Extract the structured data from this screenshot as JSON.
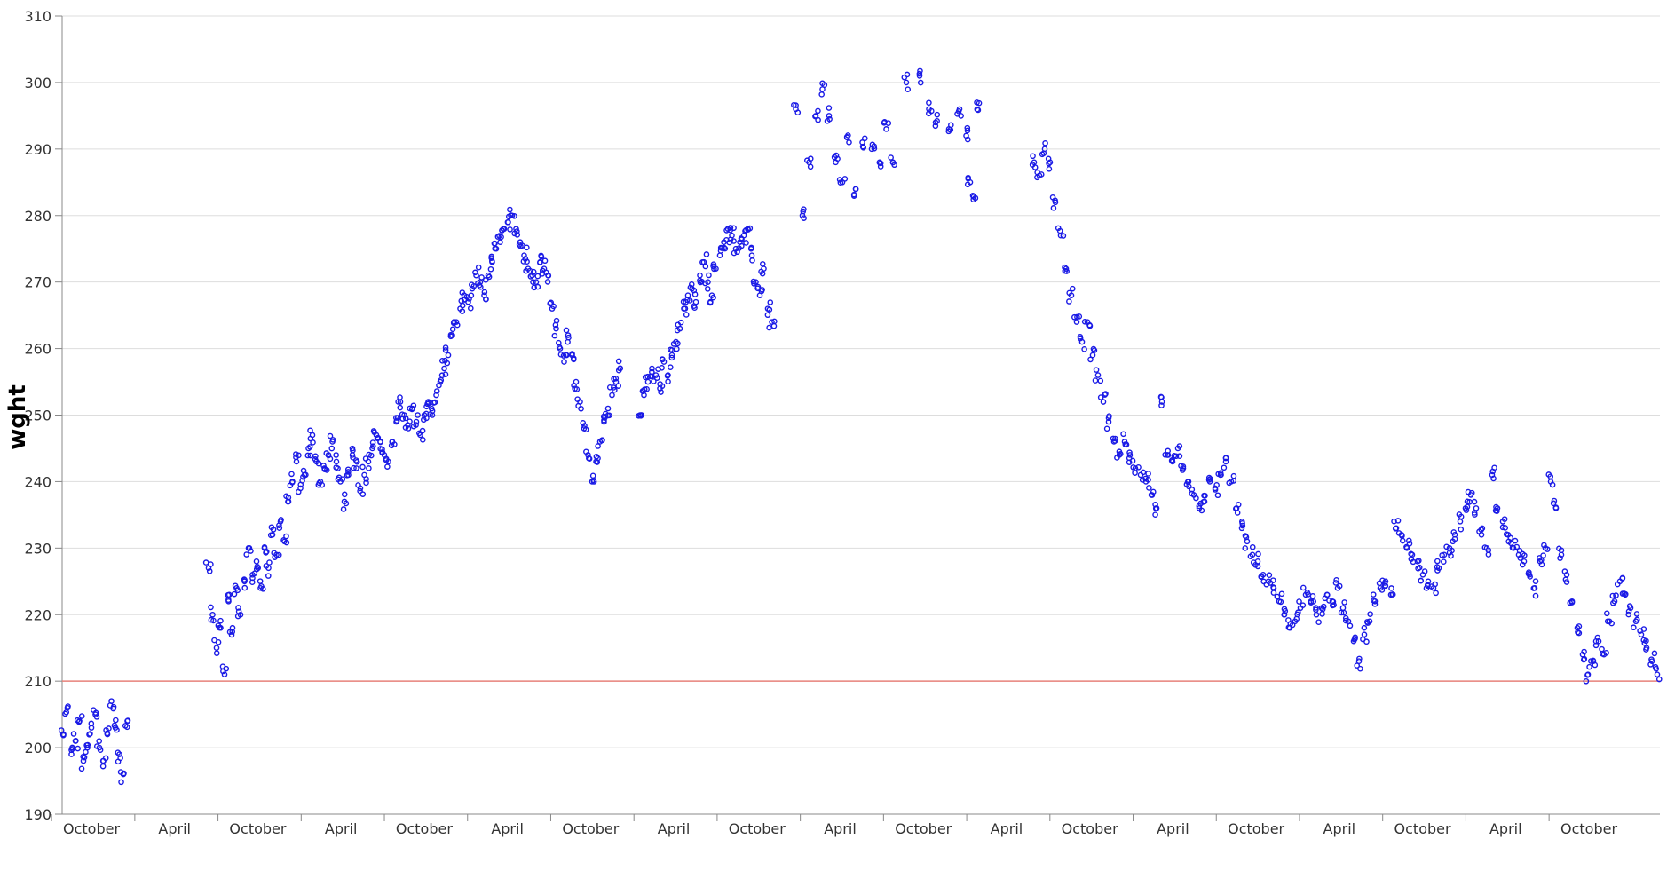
{
  "chart_data": {
    "type": "scatter",
    "title": "",
    "ylabel": "wght",
    "xlabel": "",
    "ylim": [
      190,
      310
    ],
    "yticks": [
      190,
      200,
      210,
      220,
      230,
      240,
      250,
      260,
      270,
      280,
      290,
      300,
      310
    ],
    "xticks": [
      "October",
      "April",
      "October",
      "April",
      "October",
      "April",
      "October",
      "April",
      "October",
      "April",
      "October",
      "April",
      "October",
      "April",
      "October",
      "April",
      "October",
      "April",
      "October"
    ],
    "reference_line": {
      "y": 210,
      "color": "#e8827a"
    },
    "marker": {
      "shape": "open-circle",
      "color": "#1a1ae6"
    },
    "grid": "horizontal",
    "points": [
      [
        0.1,
        202
      ],
      [
        0.4,
        206
      ],
      [
        0.7,
        199
      ],
      [
        1.0,
        201
      ],
      [
        1.3,
        204
      ],
      [
        1.6,
        198
      ],
      [
        1.9,
        200
      ],
      [
        2.2,
        203
      ],
      [
        2.5,
        205
      ],
      [
        2.8,
        200
      ],
      [
        3.1,
        198
      ],
      [
        3.4,
        202
      ],
      [
        3.7,
        207
      ],
      [
        4.0,
        203
      ],
      [
        4.3,
        199
      ],
      [
        4.6,
        196
      ],
      [
        4.9,
        204
      ],
      [
        11.0,
        227
      ],
      [
        11.3,
        220
      ],
      [
        11.6,
        215
      ],
      [
        11.9,
        218
      ],
      [
        12.2,
        211
      ],
      [
        12.5,
        222
      ],
      [
        12.8,
        218
      ],
      [
        13.1,
        224
      ],
      [
        13.4,
        220
      ],
      [
        13.7,
        225
      ],
      [
        14.0,
        230
      ],
      [
        14.3,
        226
      ],
      [
        14.6,
        228
      ],
      [
        14.9,
        224
      ],
      [
        15.2,
        230
      ],
      [
        15.5,
        227
      ],
      [
        15.8,
        232
      ],
      [
        16.1,
        229
      ],
      [
        16.4,
        234
      ],
      [
        16.7,
        231
      ],
      [
        17.0,
        237
      ],
      [
        17.3,
        240
      ],
      [
        17.6,
        243
      ],
      [
        17.9,
        239
      ],
      [
        18.2,
        241
      ],
      [
        18.5,
        245
      ],
      [
        18.8,
        247
      ],
      [
        19.1,
        243
      ],
      [
        19.4,
        240
      ],
      [
        19.7,
        242
      ],
      [
        20.0,
        244
      ],
      [
        20.3,
        246
      ],
      [
        20.6,
        243
      ],
      [
        20.9,
        240
      ],
      [
        21.2,
        237
      ],
      [
        21.5,
        241
      ],
      [
        21.8,
        244
      ],
      [
        22.1,
        242
      ],
      [
        22.4,
        239
      ],
      [
        22.7,
        241
      ],
      [
        23.0,
        243
      ],
      [
        23.3,
        245
      ],
      [
        23.6,
        247
      ],
      [
        23.9,
        246
      ],
      [
        24.2,
        244
      ],
      [
        24.5,
        243
      ],
      [
        24.8,
        246
      ],
      [
        25.1,
        249
      ],
      [
        25.4,
        252
      ],
      [
        25.7,
        250
      ],
      [
        26.0,
        248
      ],
      [
        26.3,
        251
      ],
      [
        26.6,
        249
      ],
      [
        26.9,
        247
      ],
      [
        27.2,
        250
      ],
      [
        27.5,
        252
      ],
      [
        27.8,
        250
      ],
      [
        28.1,
        253
      ],
      [
        28.4,
        255
      ],
      [
        28.7,
        257
      ],
      [
        29.0,
        259
      ],
      [
        29.3,
        262
      ],
      [
        29.6,
        264
      ],
      [
        29.9,
        266
      ],
      [
        30.2,
        268
      ],
      [
        30.5,
        267
      ],
      [
        30.8,
        269
      ],
      [
        31.1,
        271
      ],
      [
        31.4,
        270
      ],
      [
        31.7,
        268
      ],
      [
        32.0,
        271
      ],
      [
        32.3,
        273
      ],
      [
        32.6,
        275
      ],
      [
        32.9,
        276
      ],
      [
        33.2,
        278
      ],
      [
        33.5,
        279
      ],
      [
        33.8,
        280
      ],
      [
        34.1,
        278
      ],
      [
        34.4,
        276
      ],
      [
        34.7,
        274
      ],
      [
        35.0,
        272
      ],
      [
        35.3,
        271
      ],
      [
        35.6,
        270
      ],
      [
        35.9,
        273
      ],
      [
        36.2,
        272
      ],
      [
        36.5,
        271
      ],
      [
        36.8,
        266
      ],
      [
        37.1,
        263
      ],
      [
        37.4,
        260
      ],
      [
        37.7,
        258
      ],
      [
        38.0,
        262
      ],
      [
        38.3,
        259
      ],
      [
        38.6,
        255
      ],
      [
        38.9,
        252
      ],
      [
        39.2,
        248
      ],
      [
        39.5,
        244
      ],
      [
        39.8,
        240
      ],
      [
        40.1,
        243
      ],
      [
        40.4,
        246
      ],
      [
        40.7,
        249
      ],
      [
        41.0,
        251
      ],
      [
        41.3,
        253
      ],
      [
        41.6,
        255
      ],
      [
        41.9,
        257
      ],
      [
        43.4,
        250
      ],
      [
        43.7,
        253
      ],
      [
        44.0,
        255
      ],
      [
        44.3,
        257
      ],
      [
        44.6,
        256
      ],
      [
        44.9,
        254
      ],
      [
        45.2,
        258
      ],
      [
        45.5,
        256
      ],
      [
        45.8,
        259
      ],
      [
        46.1,
        261
      ],
      [
        46.4,
        263
      ],
      [
        46.7,
        266
      ],
      [
        47.0,
        268
      ],
      [
        47.3,
        269
      ],
      [
        47.6,
        267
      ],
      [
        47.9,
        271
      ],
      [
        48.2,
        273
      ],
      [
        48.5,
        270
      ],
      [
        48.8,
        268
      ],
      [
        49.1,
        272
      ],
      [
        49.4,
        274
      ],
      [
        49.7,
        276
      ],
      [
        50.0,
        278
      ],
      [
        50.3,
        277
      ],
      [
        50.6,
        275
      ],
      [
        50.9,
        276
      ],
      [
        51.2,
        277
      ],
      [
        51.5,
        278
      ],
      [
        51.8,
        274
      ],
      [
        52.1,
        270
      ],
      [
        52.4,
        268
      ],
      [
        52.7,
        272
      ],
      [
        53.0,
        266
      ],
      [
        53.3,
        264
      ],
      [
        55.1,
        296
      ],
      [
        55.6,
        280
      ],
      [
        56.1,
        288
      ],
      [
        56.6,
        295
      ],
      [
        57.1,
        299
      ],
      [
        57.6,
        295
      ],
      [
        58.1,
        288
      ],
      [
        58.6,
        285
      ],
      [
        59.1,
        291
      ],
      [
        59.6,
        284
      ],
      [
        60.1,
        291
      ],
      [
        60.8,
        290
      ],
      [
        61.4,
        288
      ],
      [
        61.9,
        293
      ],
      [
        62.4,
        288
      ],
      [
        63.4,
        300
      ],
      [
        64.4,
        301
      ],
      [
        65.1,
        296
      ],
      [
        65.6,
        294
      ],
      [
        66.6,
        293
      ],
      [
        67.4,
        296
      ],
      [
        67.9,
        292
      ],
      [
        68.2,
        285
      ],
      [
        68.4,
        283
      ],
      [
        68.7,
        297
      ],
      [
        73.0,
        288
      ],
      [
        73.4,
        286
      ],
      [
        73.8,
        290
      ],
      [
        74.2,
        288
      ],
      [
        74.6,
        282
      ],
      [
        75.0,
        277
      ],
      [
        75.4,
        272
      ],
      [
        75.8,
        268
      ],
      [
        76.2,
        264
      ],
      [
        76.6,
        261
      ],
      [
        77.0,
        264
      ],
      [
        77.4,
        259
      ],
      [
        77.8,
        256
      ],
      [
        78.2,
        252
      ],
      [
        78.6,
        249
      ],
      [
        79.0,
        246
      ],
      [
        79.4,
        244
      ],
      [
        79.8,
        246
      ],
      [
        80.2,
        244
      ],
      [
        80.6,
        242
      ],
      [
        81.0,
        241
      ],
      [
        81.4,
        240
      ],
      [
        81.8,
        238
      ],
      [
        82.2,
        236
      ],
      [
        82.6,
        252
      ],
      [
        83.0,
        244
      ],
      [
        83.4,
        243
      ],
      [
        83.8,
        245
      ],
      [
        84.2,
        242
      ],
      [
        84.6,
        240
      ],
      [
        85.0,
        238
      ],
      [
        85.4,
        236
      ],
      [
        85.8,
        237
      ],
      [
        86.2,
        240
      ],
      [
        86.6,
        239
      ],
      [
        87.0,
        241
      ],
      [
        87.4,
        243
      ],
      [
        87.8,
        240
      ],
      [
        88.2,
        236
      ],
      [
        88.6,
        233
      ],
      [
        89.0,
        231
      ],
      [
        89.4,
        229
      ],
      [
        89.8,
        228
      ],
      [
        90.2,
        226
      ],
      [
        90.6,
        225
      ],
      [
        91.0,
        224
      ],
      [
        91.4,
        222
      ],
      [
        91.8,
        220
      ],
      [
        92.2,
        218
      ],
      [
        92.6,
        219
      ],
      [
        93.0,
        221
      ],
      [
        93.4,
        223
      ],
      [
        93.8,
        222
      ],
      [
        94.2,
        220
      ],
      [
        94.6,
        221
      ],
      [
        95.0,
        223
      ],
      [
        95.4,
        222
      ],
      [
        95.8,
        224
      ],
      [
        96.2,
        221
      ],
      [
        96.6,
        219
      ],
      [
        97.0,
        216
      ],
      [
        97.4,
        213
      ],
      [
        97.8,
        217
      ],
      [
        98.2,
        219
      ],
      [
        98.6,
        222
      ],
      [
        99.0,
        224
      ],
      [
        99.4,
        225
      ],
      [
        99.8,
        223
      ],
      [
        100.2,
        233
      ],
      [
        100.6,
        232
      ],
      [
        101.0,
        230
      ],
      [
        101.4,
        229
      ],
      [
        101.8,
        228
      ],
      [
        102.2,
        226
      ],
      [
        102.6,
        225
      ],
      [
        103.0,
        224
      ],
      [
        103.4,
        227
      ],
      [
        103.8,
        229
      ],
      [
        104.2,
        230
      ],
      [
        104.6,
        232
      ],
      [
        105.0,
        234
      ],
      [
        105.4,
        236
      ],
      [
        105.8,
        238
      ],
      [
        106.2,
        236
      ],
      [
        106.6,
        232
      ],
      [
        107.0,
        230
      ],
      [
        107.4,
        241
      ],
      [
        107.8,
        236
      ],
      [
        108.2,
        234
      ],
      [
        108.6,
        232
      ],
      [
        109.0,
        230
      ],
      [
        109.4,
        229
      ],
      [
        109.8,
        228
      ],
      [
        110.2,
        226
      ],
      [
        110.6,
        224
      ],
      [
        111.0,
        228
      ],
      [
        111.4,
        230
      ],
      [
        111.8,
        240
      ],
      [
        112.2,
        236
      ],
      [
        112.6,
        229
      ],
      [
        113.0,
        226
      ],
      [
        113.4,
        222
      ],
      [
        113.8,
        218
      ],
      [
        114.2,
        214
      ],
      [
        114.6,
        211
      ],
      [
        115.0,
        213
      ],
      [
        115.4,
        216
      ],
      [
        115.8,
        214
      ],
      [
        116.2,
        219
      ],
      [
        116.6,
        222
      ],
      [
        117.0,
        225
      ],
      [
        117.4,
        223
      ],
      [
        117.8,
        221
      ],
      [
        118.2,
        219
      ],
      [
        118.6,
        217
      ],
      [
        119.0,
        215
      ],
      [
        119.4,
        213
      ],
      [
        119.8,
        211
      ]
    ],
    "x_domain": [
      0,
      120
    ]
  }
}
